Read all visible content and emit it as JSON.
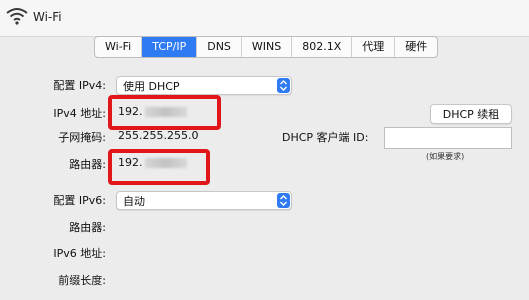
{
  "window": {
    "title": "Wi-Fi"
  },
  "tabs": [
    {
      "label": "Wi-Fi"
    },
    {
      "label": "TCP/IP"
    },
    {
      "label": "DNS"
    },
    {
      "label": "WINS"
    },
    {
      "label": "802.1X"
    },
    {
      "label": "代理"
    },
    {
      "label": "硬件"
    }
  ],
  "ipv4": {
    "config_label": "配置 IPv4:",
    "config_value": "使用 DHCP",
    "address_label": "IPv4 地址:",
    "address_value": "192.",
    "subnet_label": "子网掩码:",
    "subnet_value": "255.255.255.0",
    "router_label": "路由器:",
    "router_value": "192.",
    "renew_button": "DHCP 续租",
    "client_id_label": "DHCP 客户端 ID:",
    "client_id_value": "",
    "client_id_hint": "(如果要求)"
  },
  "ipv6": {
    "config_label": "配置 IPv6:",
    "config_value": "自动",
    "router_label": "路由器:",
    "address_label": "IPv6 地址:",
    "prefix_label": "前缀长度:"
  },
  "colors": {
    "accent": "#2f7bf3",
    "highlight_border": "#e0161a"
  }
}
